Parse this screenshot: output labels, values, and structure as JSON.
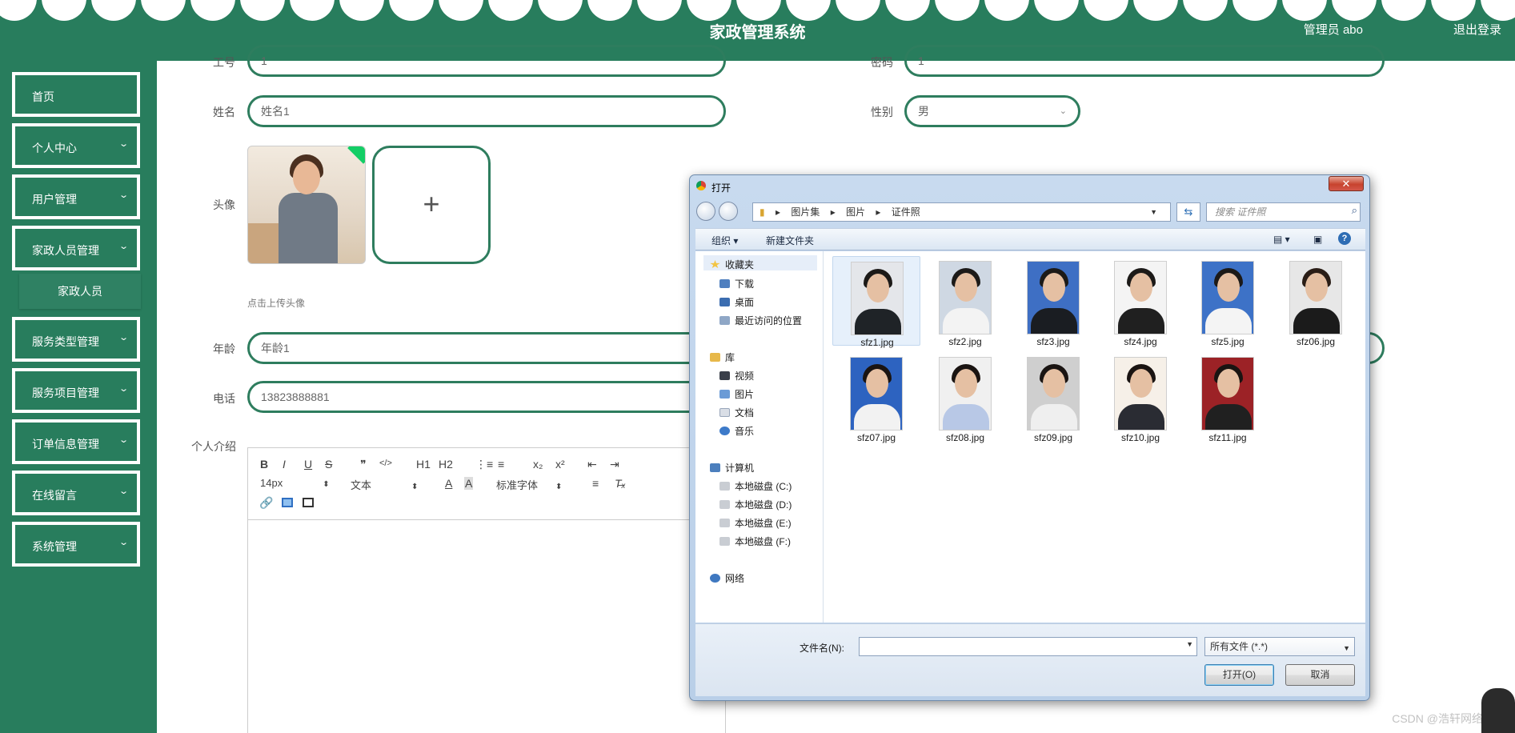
{
  "header": {
    "title": "家政管理系统",
    "admin": "管理员 abo",
    "logout": "退出登录"
  },
  "sidebar": {
    "items": [
      {
        "label": "首页"
      },
      {
        "label": "个人中心"
      },
      {
        "label": "用户管理"
      },
      {
        "label": "家政人员管理"
      },
      {
        "label": "服务类型管理"
      },
      {
        "label": "服务项目管理"
      },
      {
        "label": "订单信息管理"
      },
      {
        "label": "在线留言"
      },
      {
        "label": "系统管理"
      }
    ],
    "sub_item": "家政人员"
  },
  "form": {
    "gonghao_label": "工号",
    "gonghao_value": "1",
    "mima_label": "密码",
    "mima_value": "1",
    "name_label": "姓名",
    "name_value": "姓名1",
    "gender_label": "性别",
    "gender_value": "男",
    "avatar_label": "头像",
    "upload_hint": "点击上传头像",
    "age_label": "年龄",
    "age_value": "年龄1",
    "phone_label": "电话",
    "phone_value": "13823888881",
    "intro_label": "个人介绍",
    "editor": {
      "row1": [
        "B",
        "I",
        "U",
        "S",
        "❞",
        "</>",
        "H1",
        "H2",
        "⋮≡",
        "≡",
        "x₂",
        "x²",
        "⇤",
        "⇥"
      ],
      "font_size": "14px",
      "text_style": "文本",
      "font_family": "标准字体"
    }
  },
  "dialog": {
    "title": "打开",
    "breadcrumb": [
      "图片集",
      "图片",
      "证件照"
    ],
    "search_placeholder": "搜索 证件照",
    "organize": "组织 ▾",
    "new_folder": "新建文件夹",
    "nav": {
      "favorites": "收藏夹",
      "favorites_items": [
        "下载",
        "桌面",
        "最近访问的位置"
      ],
      "library": "库",
      "library_items": [
        "视频",
        "图片",
        "文档",
        "音乐"
      ],
      "computer": "计算机",
      "drives": [
        "本地磁盘 (C:)",
        "本地磁盘 (D:)",
        "本地磁盘 (E:)",
        "本地磁盘 (F:)"
      ],
      "network": "网络"
    },
    "files": [
      {
        "name": "sfz1.jpg",
        "bg": "#e4e6ea",
        "hair": "#1c1a18",
        "body": "#1f2327"
      },
      {
        "name": "sfz2.jpg",
        "bg": "#cfd8e3",
        "hair": "#1c1a18",
        "body": "#f3f3f3"
      },
      {
        "name": "sfz3.jpg",
        "bg": "#3e6fc4",
        "hair": "#1c1a18",
        "body": "#1a1d22"
      },
      {
        "name": "sfz4.jpg",
        "bg": "#f4f4f4",
        "hair": "#1c1a18",
        "body": "#202020"
      },
      {
        "name": "sfz5.jpg",
        "bg": "#3d72c7",
        "hair": "#1c1a18",
        "body": "#f4f4f4"
      },
      {
        "name": "sfz06.jpg",
        "bg": "#e7e7e7",
        "hair": "#2a1d16",
        "body": "#1b1b1b"
      },
      {
        "name": "sfz07.jpg",
        "bg": "#2d63c0",
        "hair": "#1a1412",
        "body": "#f2f2f2"
      },
      {
        "name": "sfz08.jpg",
        "bg": "#f0f0f0",
        "hair": "#1a1412",
        "body": "#b8c8e6"
      },
      {
        "name": "sfz09.jpg",
        "bg": "#cfcfcf",
        "hair": "#1a1412",
        "body": "#efefef"
      },
      {
        "name": "sfz10.jpg",
        "bg": "#f6f0e8",
        "hair": "#1a1412",
        "body": "#2a2c33"
      },
      {
        "name": "sfz11.jpg",
        "bg": "#9c2226",
        "hair": "#1a1412",
        "body": "#202020"
      }
    ],
    "filename_label": "文件名(N):",
    "filter": "所有文件 (*.*)",
    "open_button": "打开(O)",
    "cancel_button": "取消"
  },
  "watermark": "CSDN @浩轩网络"
}
